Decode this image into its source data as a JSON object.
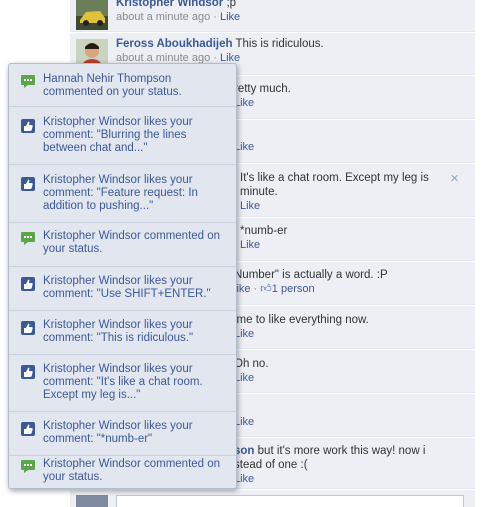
{
  "thread": {
    "comments": [
      {
        "author": "Kristopher Windsor",
        "text": ";p",
        "time": "about a minute ago",
        "like": "Like",
        "avatar": "car-avatar"
      },
      {
        "author": "Feross Aboukhadijeh",
        "text": "This is ridiculous.",
        "time": "about a minute ago",
        "like": "Like",
        "avatar": "person-avatar"
      },
      {
        "text": "retty much.",
        "like": "Like"
      },
      {
        "text": ")",
        "like": "Like"
      },
      {
        "text": "It's like a chat room. Except my leg is",
        "text2": "minute.",
        "like": "Like",
        "close": "×"
      },
      {
        "text": "*numb-er",
        "like": "Like"
      },
      {
        "text": "Number\" is actually a word. :P",
        "like": "like",
        "likes_count": "1 person"
      },
      {
        "text": "ime to like everything now.",
        "like": "Like"
      },
      {
        "text": "Oh no.",
        "like": "Like"
      },
      {
        "text": ")",
        "like": "Like"
      },
      {
        "text_link": "son",
        "text": "but it's more work this way! now i",
        "text2": "stead of one :(",
        "like": "Like"
      }
    ]
  },
  "flyout": {
    "notifications": [
      {
        "text": "Hannah Nehir Thompson commented on your status.",
        "icon": "comment-icon",
        "color": "#5ba54a"
      },
      {
        "text": "Kristopher Windsor likes your comment: \"Blurring the lines between chat and...\"",
        "icon": "thumbs-up-icon",
        "color": "#3b5998"
      },
      {
        "text": "Kristopher Windsor likes your comment: \"Feature request: In addition to pushing...\"",
        "icon": "thumbs-up-icon",
        "color": "#3b5998"
      },
      {
        "text": "Kristopher Windsor commented on your status.",
        "icon": "comment-icon",
        "color": "#5ba54a"
      },
      {
        "text": "Kristopher Windsor likes your comment: \"Use SHIFT+ENTER.\"",
        "icon": "thumbs-up-icon",
        "color": "#3b5998"
      },
      {
        "text": "Kristopher Windsor likes your comment: \"This is ridiculous.\"",
        "icon": "thumbs-up-icon",
        "color": "#3b5998"
      },
      {
        "text": "Kristopher Windsor likes your comment: \"It's like a chat room. Except my leg is...\"",
        "icon": "thumbs-up-icon",
        "color": "#3b5998"
      },
      {
        "text": "Kristopher Windsor likes your comment: \"*numb-er\"",
        "icon": "thumbs-up-icon",
        "color": "#3b5998"
      },
      {
        "text": "Kristopher Windsor commented on your status.",
        "icon": "comment-icon",
        "color": "#5ba54a"
      }
    ]
  }
}
